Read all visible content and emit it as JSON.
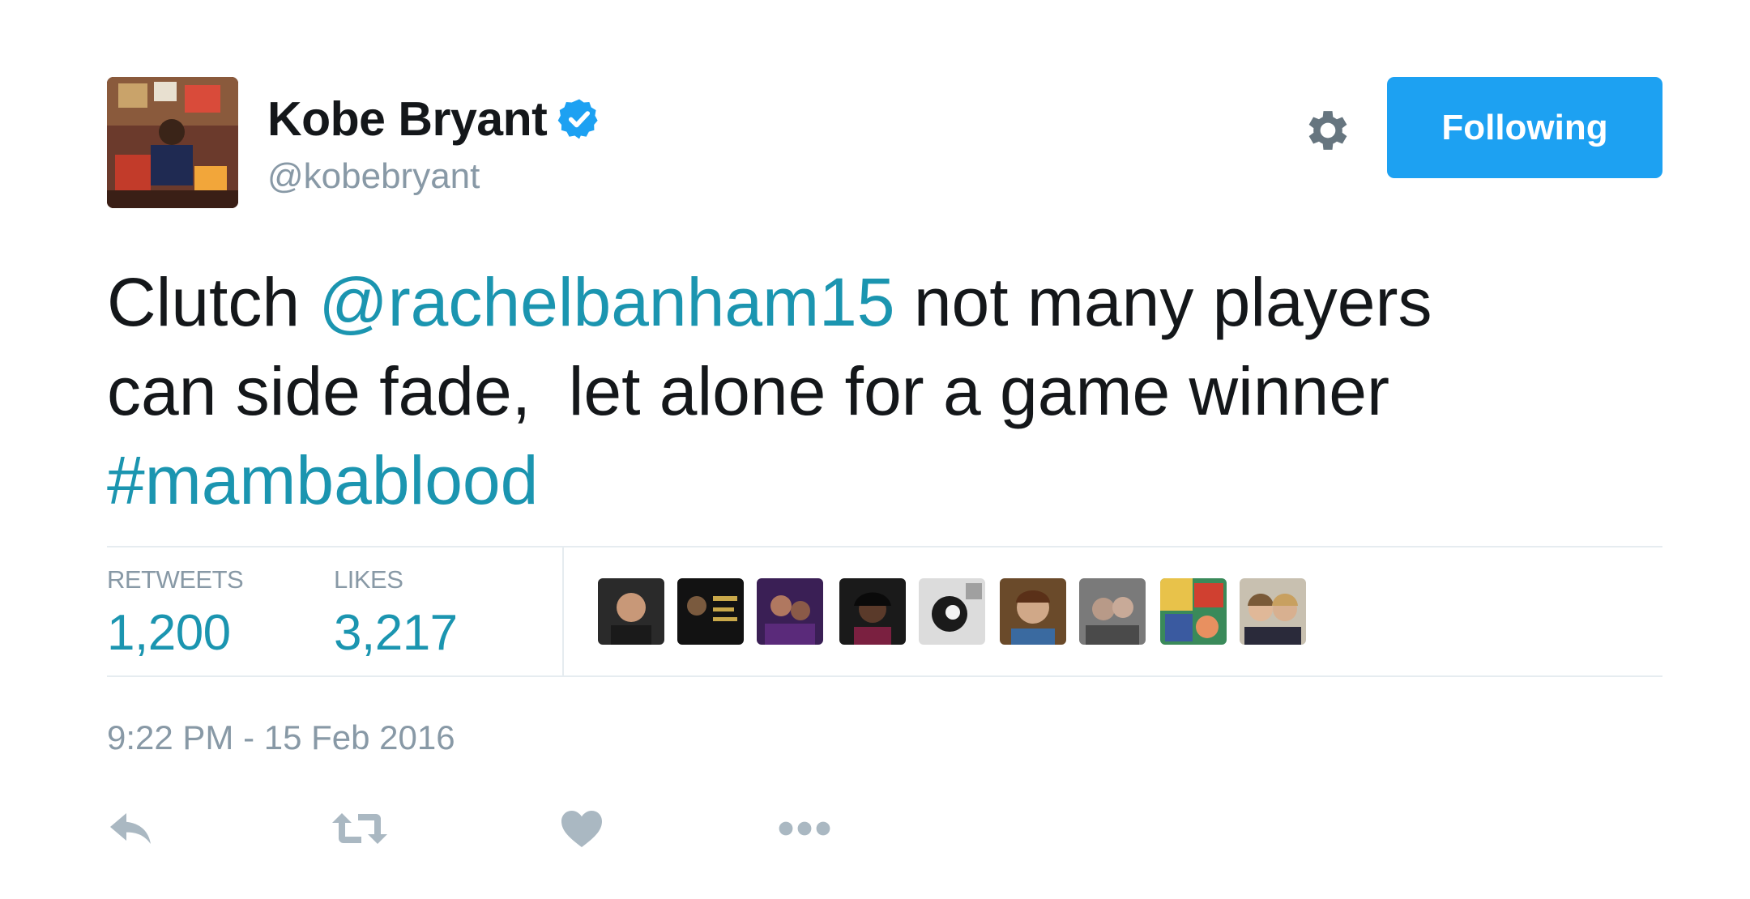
{
  "author": {
    "name": "Kobe Bryant",
    "handle": "@kobebryant",
    "verified": true
  },
  "header": {
    "settings_icon": "gear-icon",
    "follow_button_label": "Following"
  },
  "tweet": {
    "lines": [
      [
        {
          "text": "Clutch ",
          "type": "plain"
        },
        {
          "text": "@rachelbanham15",
          "type": "mention"
        },
        {
          "text": " not many players",
          "type": "plain"
        }
      ],
      [
        {
          "text": "can side fade,  let alone for a game winner",
          "type": "plain"
        }
      ],
      [
        {
          "text": "#mambablood",
          "type": "hashtag"
        }
      ]
    ]
  },
  "stats": {
    "retweets_label": "RETWEETS",
    "retweets_value": "1,200",
    "likes_label": "LIKES",
    "likes_value": "3,217"
  },
  "likers": [
    {
      "name": "liker-avatar-1"
    },
    {
      "name": "liker-avatar-2"
    },
    {
      "name": "liker-avatar-3"
    },
    {
      "name": "liker-avatar-4"
    },
    {
      "name": "liker-avatar-5"
    },
    {
      "name": "liker-avatar-6"
    },
    {
      "name": "liker-avatar-7"
    },
    {
      "name": "liker-avatar-8"
    },
    {
      "name": "liker-avatar-9"
    }
  ],
  "timestamp": "9:22 PM - 15 Feb 2016",
  "actions": {
    "reply_icon": "reply-icon",
    "retweet_icon": "retweet-icon",
    "like_icon": "heart-icon",
    "more_icon": "more-dots-icon"
  },
  "colors": {
    "link": "#1b95b0",
    "button": "#1da1f2",
    "muted": "#8899a6",
    "text": "#14171a",
    "divider": "#e6ecf0",
    "icon": "#aab8c2",
    "verified": "#1da1f2"
  }
}
